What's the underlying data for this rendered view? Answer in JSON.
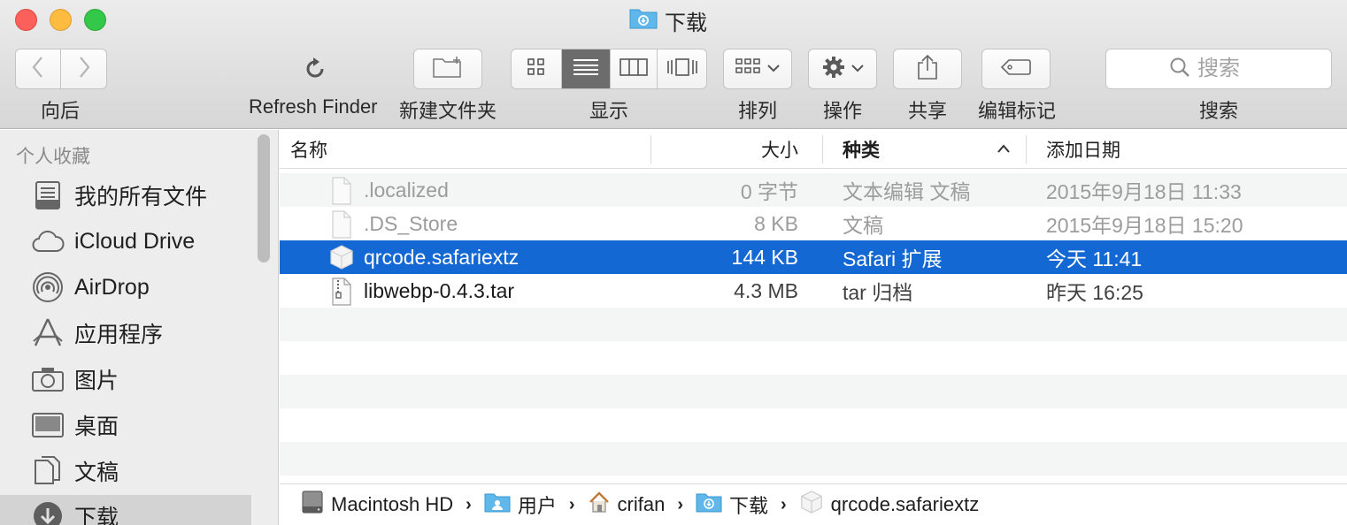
{
  "window": {
    "title": "下载"
  },
  "toolbar": {
    "back_label": "向后",
    "refresh_label": "Refresh Finder",
    "new_folder_label": "新建文件夹",
    "view_label": "显示",
    "arrange_label": "排列",
    "action_label": "操作",
    "share_label": "共享",
    "tags_label": "编辑标记",
    "search_label": "搜索",
    "search_placeholder": "搜索"
  },
  "sidebar": {
    "header": "个人收藏",
    "items": [
      {
        "label": "我的所有文件",
        "icon": "all-files-icon"
      },
      {
        "label": "iCloud Drive",
        "icon": "cloud-icon"
      },
      {
        "label": "AirDrop",
        "icon": "airdrop-icon"
      },
      {
        "label": "应用程序",
        "icon": "applications-icon"
      },
      {
        "label": "图片",
        "icon": "camera-icon"
      },
      {
        "label": "桌面",
        "icon": "desktop-icon"
      },
      {
        "label": "文稿",
        "icon": "documents-icon"
      },
      {
        "label": "下载",
        "icon": "download-icon",
        "selected": true
      }
    ]
  },
  "file_list": {
    "columns": {
      "name": "名称",
      "size": "大小",
      "kind": "种类",
      "date": "添加日期"
    },
    "rows": [
      {
        "name": ".localized",
        "size": "0 字节",
        "kind": "文本编辑 文稿",
        "date": "2015年9月18日 11:33"
      },
      {
        "name": ".DS_Store",
        "size": "8 KB",
        "kind": "文稿",
        "date": "2015年9月18日 15:20"
      },
      {
        "name": "qrcode.safariextz",
        "size": "144 KB",
        "kind": "Safari 扩展",
        "date": "今天 11:41"
      },
      {
        "name": "libwebp-0.4.3.tar",
        "size": "4.3 MB",
        "kind": "tar 归档",
        "date": "昨天 16:25"
      }
    ]
  },
  "pathbar": {
    "segments": [
      "Macintosh HD",
      "用户",
      "crifan",
      "下载",
      "qrcode.safariextz"
    ],
    "separator": "›"
  },
  "colors": {
    "selection": "#1468d3",
    "folder": "#5fb7ea"
  }
}
